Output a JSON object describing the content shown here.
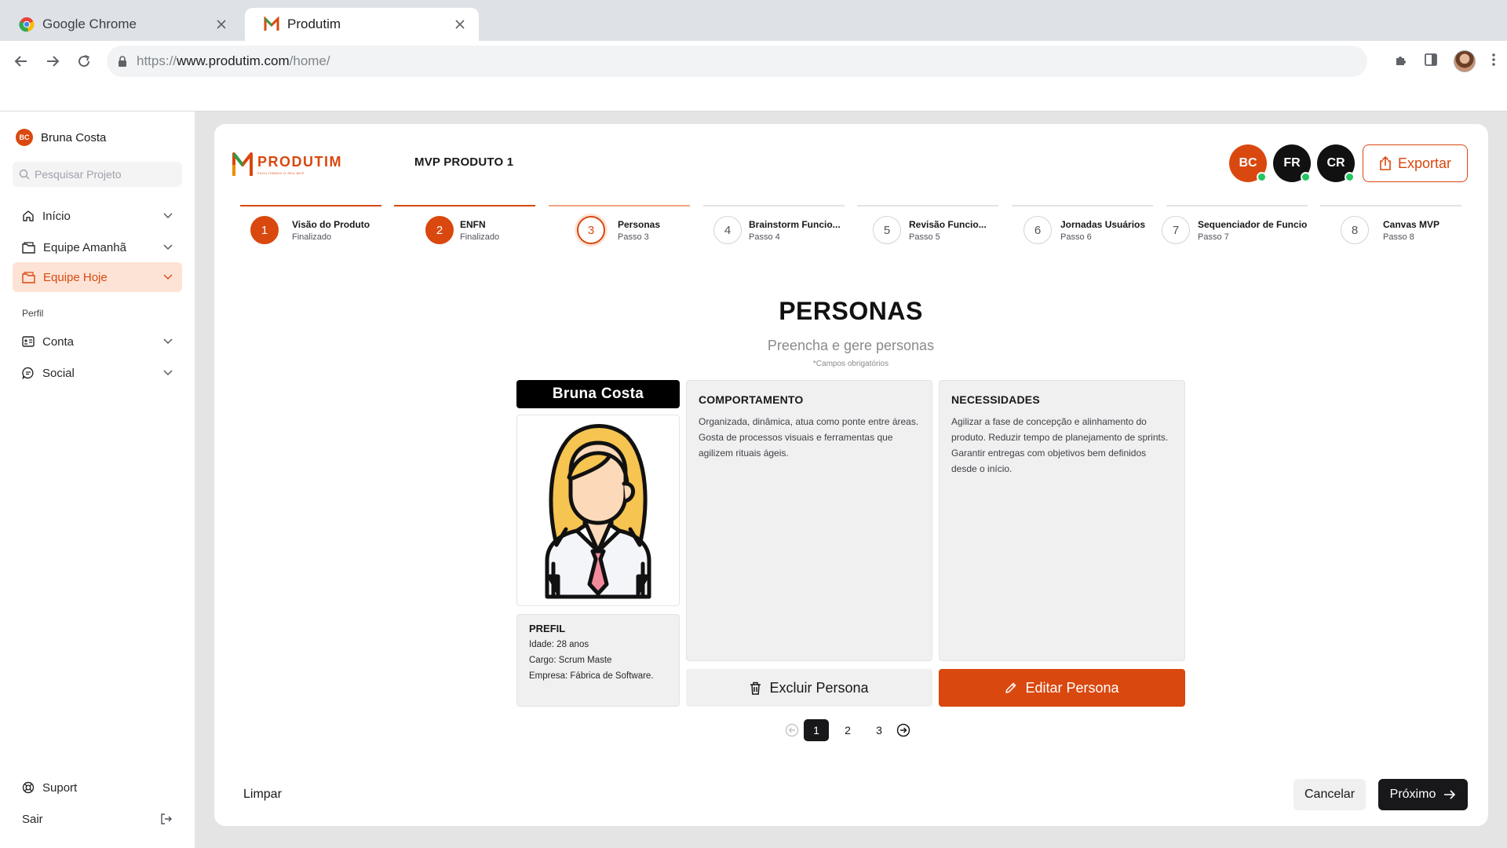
{
  "browser": {
    "tabs": [
      {
        "title": "Google Chrome",
        "active": false
      },
      {
        "title": "Produtim",
        "active": true
      }
    ],
    "url": {
      "scheme": "https://",
      "host": "www.produtim.com",
      "path": "/home/"
    }
  },
  "sidebar": {
    "user": {
      "initials": "BC",
      "name": "Bruna Costa"
    },
    "search_placeholder": "Pesquisar Projeto",
    "items": [
      {
        "label": "Início",
        "icon": "home-icon"
      },
      {
        "label": "Equipe Amanhã",
        "icon": "folder-icon"
      },
      {
        "label": "Equipe Hoje",
        "icon": "folder-icon",
        "active": true
      }
    ],
    "section_label": "Perfil",
    "profile_items": [
      {
        "label": "Conta",
        "icon": "id-card-icon"
      },
      {
        "label": "Social",
        "icon": "chat-icon"
      }
    ],
    "support_label": "Suport",
    "logout_label": "Sair"
  },
  "header": {
    "logo_name": "PRODUTIM",
    "logo_tagline": "FACILITANDO O SEU MVP",
    "project_title": "MVP PRODUTO 1",
    "team": [
      {
        "initials": "BC",
        "color": "#d9480f",
        "online": true
      },
      {
        "initials": "FR",
        "color": "#111111",
        "online": true
      },
      {
        "initials": "CR",
        "color": "#111111",
        "online": true
      }
    ],
    "export_label": "Exportar"
  },
  "steps": [
    {
      "number": "1",
      "title": "Visão do Produto",
      "subtitle": "Finalizado",
      "state": "done"
    },
    {
      "number": "2",
      "title": "ENFN",
      "subtitle": "Finalizado",
      "state": "done"
    },
    {
      "number": "3",
      "title": "Personas",
      "subtitle": "Passo 3",
      "state": "current"
    },
    {
      "number": "4",
      "title": "Brainstorm Funcio...",
      "subtitle": "Passo 4",
      "state": "todo"
    },
    {
      "number": "5",
      "title": "Revisão Funcio...",
      "subtitle": "Passo 5",
      "state": "todo"
    },
    {
      "number": "6",
      "title": "Jornadas Usuários",
      "subtitle": "Passo 6",
      "state": "todo"
    },
    {
      "number": "7",
      "title": "Sequenciador de Funcio...",
      "subtitle": "Passo 7",
      "state": "todo"
    },
    {
      "number": "8",
      "title": "Canvas MVP",
      "subtitle": "Passo 8",
      "state": "todo"
    }
  ],
  "personas": {
    "title": "PERSONAS",
    "subtitle": "Preencha e gere personas",
    "note": "*Campos obrigatórios",
    "current": {
      "name": "Bruna  Costa",
      "profile_title": "PREFIL",
      "profile_lines": [
        "Idade: 28 anos",
        "Cargo: Scrum Maste",
        "Empresa: Fábrica de Software."
      ],
      "behavior_title": "COMPORTAMENTO",
      "behavior_text": "Organizada, dinâmica, atua como ponte entre áreas. Gosta de processos visuais e ferramentas que agilizem rituais ágeis.",
      "needs_title": "NECESSIDADES",
      "needs_text": "Agilizar a fase de concepção e alinhamento do produto. Reduzir tempo de planejamento de sprints. Garantir entregas com objetivos bem definidos desde o início."
    },
    "delete_label": "Excluir Persona",
    "edit_label": "Editar Persona",
    "pages": [
      "1",
      "2",
      "3"
    ],
    "current_page": "1"
  },
  "footer": {
    "clear_label": "Limpar",
    "cancel_label": "Cancelar",
    "next_label": "Próximo"
  },
  "colors": {
    "accent": "#d9480f",
    "dark": "#18181b",
    "online": "#22c55e"
  }
}
